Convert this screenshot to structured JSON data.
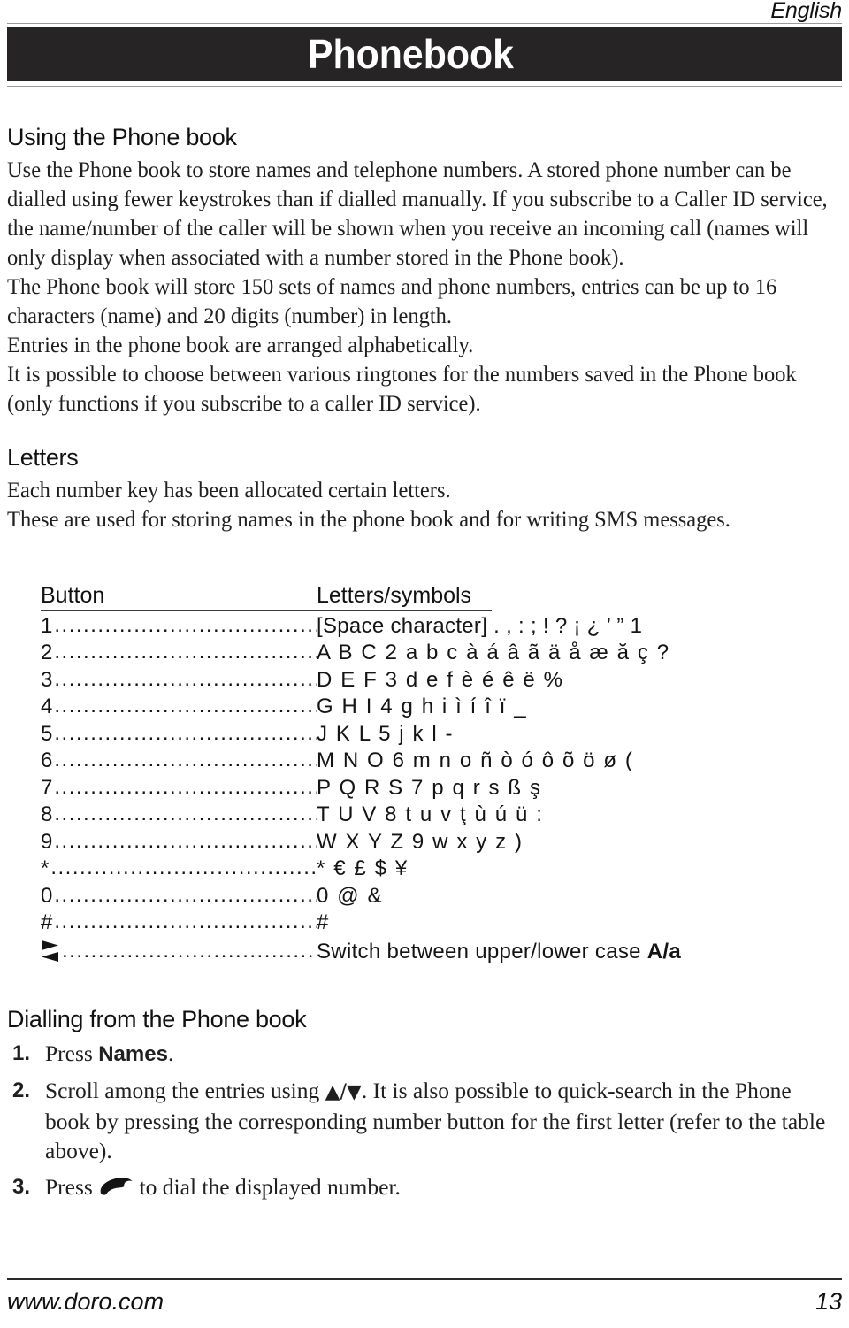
{
  "header": {
    "language": "English",
    "title": "Phonebook"
  },
  "sections": {
    "using": {
      "heading": "Using the Phone book",
      "paragraphs": [
        "Use the Phone book to store names and telephone numbers. A stored phone number can be dialled using fewer keystrokes than if dialled manually. If you subscribe to a Caller ID service, the name/number of the caller will be shown when you receive an incoming call (names will only display when associated with a number stored in the Phone book).",
        "The Phone book will store 150 sets of names and phone numbers, entries can be up to 16 characters (name) and 20 digits (number) in length.",
        "Entries in the phone book are arranged alphabetically.",
        "It is possible to choose between various ringtones for the numbers saved in the Phone book (only functions if you subscribe to a caller ID service)."
      ]
    },
    "letters": {
      "heading": "Letters",
      "paragraphs": [
        "Each number key has been allocated certain letters.",
        "These are used for storing names in the phone book and for writing SMS messages."
      ]
    },
    "dialling": {
      "heading": "Dialling from the Phone book",
      "steps": [
        {
          "num": "1.",
          "pre": "Press ",
          "bold": "Names",
          "post": "."
        },
        {
          "num": "2.",
          "pre": "Scroll among the entries using ",
          "glyphs": "▲/▼",
          "post": ". It is also possible to quick-search in the Phone book by pressing the corresponding number button for the first letter (refer to the table above)."
        },
        {
          "num": "3.",
          "pre": "Press ",
          "icon": "handset-icon",
          "post": " to dial the displayed number."
        }
      ]
    }
  },
  "key_table": {
    "columns": [
      "Button",
      "Letters/symbols"
    ],
    "leader": "...........................................",
    "rows": [
      {
        "key": "1",
        "value": "[Space character] . , : ; ! ? ¡ ¿ ’ ” 1",
        "style": "plain"
      },
      {
        "key": "2",
        "value": "A B C 2 a b c à á â ã ä å æ ă ç ?",
        "style": "spaced"
      },
      {
        "key": "3",
        "value": "D E F 3 d e f è é ê ë %",
        "style": "spaced"
      },
      {
        "key": "4",
        "value": "G H I 4 g h i ì í î ï _",
        "style": "spaced"
      },
      {
        "key": "5",
        "value": "J K L 5 j k l -",
        "style": "spaced"
      },
      {
        "key": "6",
        "value": "M N O 6 m n o ñ ò ó ô õ ö ø (",
        "style": "spaced"
      },
      {
        "key": "7",
        "value": "P Q R S 7 p q r s ß ş",
        "style": "spaced"
      },
      {
        "key": "8",
        "value": "T U V 8 t u v ţ ù ú ü :",
        "style": "spaced"
      },
      {
        "key": "9",
        "value": "W X Y Z 9 w x y z )",
        "style": "spaced"
      },
      {
        "key": "*",
        "value": "* € £ $ ¥",
        "style": "spaced"
      },
      {
        "key": "0",
        "value": "0 @ &",
        "style": "spaced"
      },
      {
        "key": "#",
        "value": "#",
        "style": "spaced"
      }
    ],
    "switch_row": {
      "key_icon": "switch-case-key-icon",
      "value_pre": "Switch between upper/lower case ",
      "value_bold": "A/a"
    }
  },
  "footer": {
    "website": "www.doro.com",
    "page_number": "13"
  },
  "colors": {
    "banner_bg": "#262424",
    "banner_text": "#ffffff",
    "body_text": "#1f1f1f",
    "rule": "#9a9a9a"
  }
}
